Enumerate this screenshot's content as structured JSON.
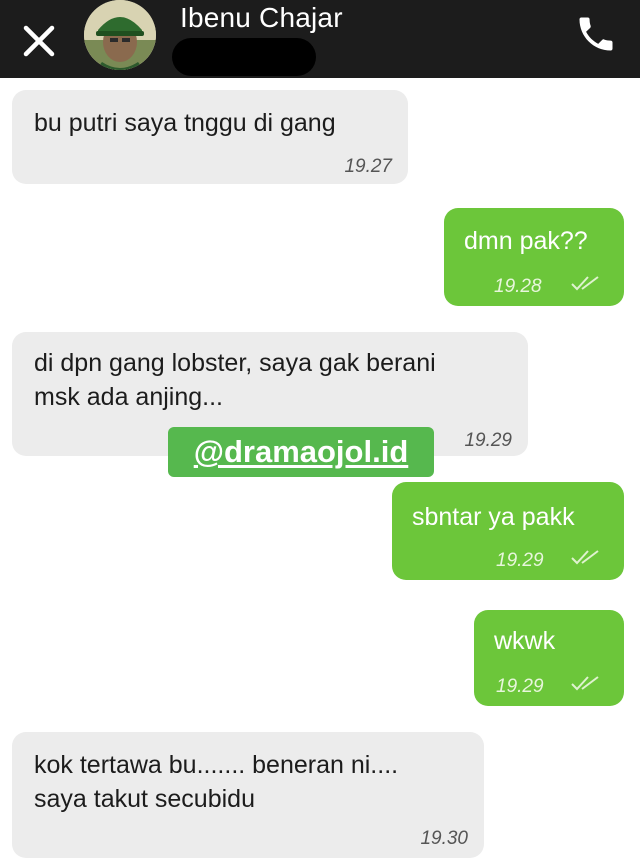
{
  "header": {
    "contact_name": "Ibenu Chajar"
  },
  "messages": [
    {
      "direction": "incoming",
      "text": "bu putri saya tnggu di gang",
      "time": "19.27"
    },
    {
      "direction": "outgoing",
      "text": "dmn pak??",
      "time": "19.28",
      "status": "read"
    },
    {
      "direction": "incoming",
      "text": "di dpn gang lobster, saya gak berani\nmsk ada anjing...",
      "time": "19.29"
    },
    {
      "direction": "outgoing",
      "text": "sbntar ya pakk",
      "time": "19.29",
      "status": "read"
    },
    {
      "direction": "outgoing",
      "text": "wkwk",
      "time": "19.29",
      "status": "read"
    },
    {
      "direction": "incoming",
      "text": "kok tertawa bu....... beneran ni....\nsaya takut secubidu",
      "time": "19.30"
    }
  ],
  "watermark": "@dramaojol.id",
  "colors": {
    "header_bg": "#1c1c1c",
    "incoming_bubble": "#ececec",
    "outgoing_bubble": "#6cc63a",
    "watermark_bg": "#56b84e"
  },
  "icons": {
    "close": "close-icon",
    "call": "phone-icon",
    "read_receipt": "double-check-icon"
  }
}
